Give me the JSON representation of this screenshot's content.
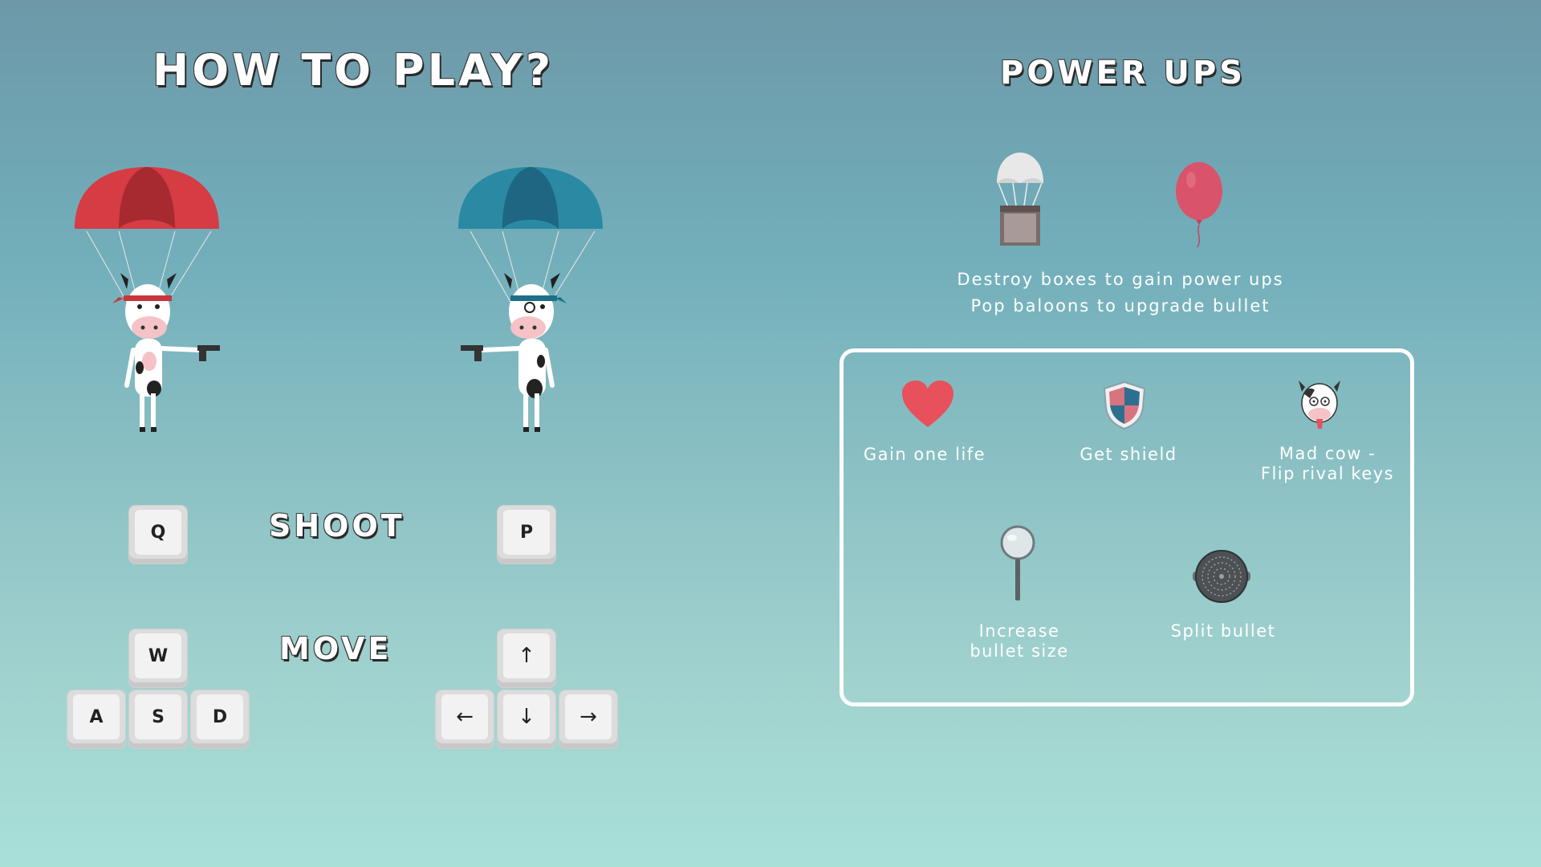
{
  "how_to_play": {
    "title": "HOW TO PLAY?",
    "shoot_label": "SHOOT",
    "move_label": "MOVE",
    "player1": {
      "color": "#c8363d",
      "shoot_key": "Q",
      "move_keys": {
        "up": "W",
        "left": "A",
        "down": "S",
        "right": "D"
      }
    },
    "player2": {
      "color": "#1f6f8b",
      "shoot_key": "P",
      "move_keys": {
        "up": "↑",
        "left": "←",
        "down": "↓",
        "right": "→"
      }
    }
  },
  "power_ups": {
    "title": "POWER UPS",
    "line1": "Destroy boxes to gain power ups",
    "line2": "Pop baloons to upgrade bullet",
    "items": [
      {
        "label": "Gain one life",
        "icon": "heart-icon"
      },
      {
        "label": "Get shield",
        "icon": "shield-icon"
      },
      {
        "label_line1": "Mad cow -",
        "label_line2": "Flip rival keys",
        "icon": "mad-cow-icon"
      },
      {
        "label_line1": "Increase",
        "label_line2": "bullet size",
        "icon": "magnifier-icon"
      },
      {
        "label": "Split bullet",
        "icon": "split-bullet-icon"
      }
    ]
  },
  "colors": {
    "heart": "#e8505b",
    "balloon": "#d9536a",
    "panel_border": "#ffffff"
  }
}
